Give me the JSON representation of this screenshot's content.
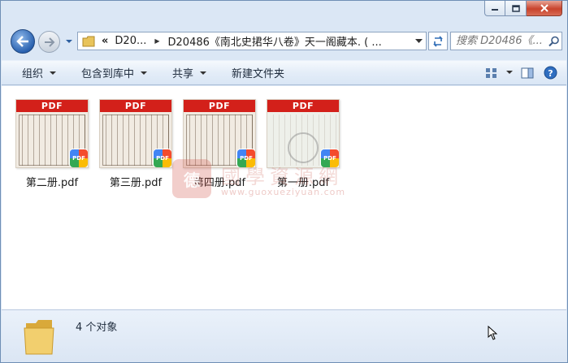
{
  "window": {
    "caption": {
      "minimize": "minimize",
      "maximize": "maximize",
      "close": "close"
    }
  },
  "address": {
    "chevron": "«",
    "crumb_root": "D20...",
    "crumb_current": "D20486《南北史捃华八卷》天一阁藏本. ( ..."
  },
  "search": {
    "placeholder": "搜索 D20486《..."
  },
  "toolbar": {
    "organize": "组织",
    "include_in_library": "包含到库中",
    "share": "共享",
    "new_folder": "新建文件夹"
  },
  "files": [
    {
      "name": "第二册.pdf",
      "header": "PDF",
      "badge": "PDF"
    },
    {
      "name": "第三册.pdf",
      "header": "PDF",
      "badge": "PDF"
    },
    {
      "name": "第四册.pdf",
      "header": "PDF",
      "badge": "PDF"
    },
    {
      "name": "第一册.pdf",
      "header": "PDF",
      "badge": "PDF"
    }
  ],
  "watermark": {
    "seal": "德",
    "title": "國學資源網",
    "url": "www.guoxueziyuan.com"
  },
  "status": {
    "count_text": "4 个对象"
  },
  "colors": {
    "pdf_header": "#d3201a",
    "toolbar_bg": "#e4edf8",
    "window_bg": "#dbe7f5"
  }
}
